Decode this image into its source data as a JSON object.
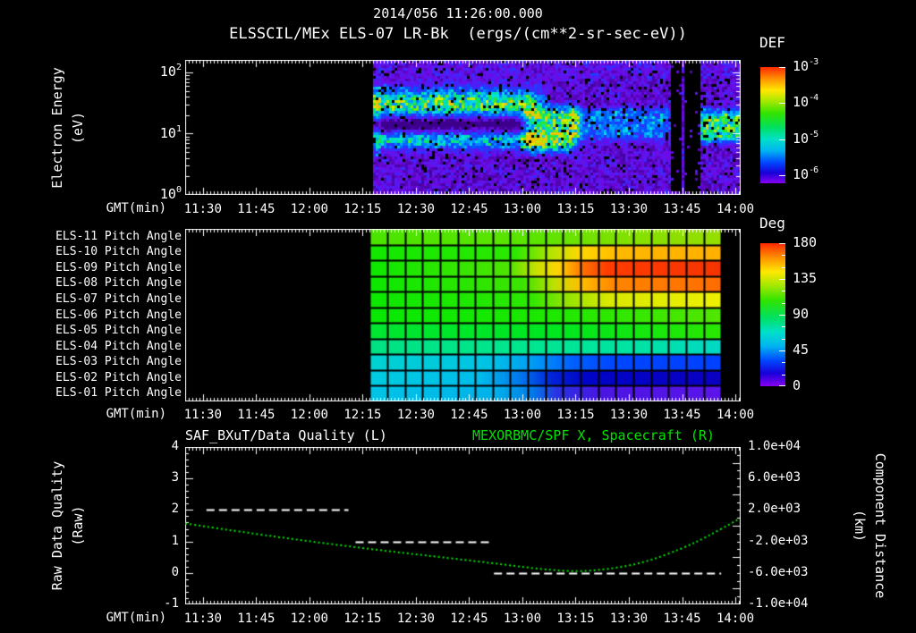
{
  "header": {
    "title": "2014/056 11:26:00.000",
    "subtitle": "ELSSCIL/MEx ELS-07 LR-Bk  (ergs/(cm**2-sr-sec-eV))"
  },
  "axes": {
    "gmt_label": "GMT(min)",
    "x_axis_start": "11:25",
    "x_axis_end": "14:01",
    "x_tick_labels": [
      "11:30",
      "11:45",
      "12:00",
      "12:15",
      "12:30",
      "12:45",
      "13:00",
      "13:15",
      "13:30",
      "13:45",
      "14:00"
    ]
  },
  "colorbars": {
    "def": {
      "title": "DEF",
      "ticks": [
        {
          "base": "10",
          "exp": "-3",
          "pos": 0.0
        },
        {
          "base": "10",
          "exp": "-4",
          "pos": 0.31
        },
        {
          "base": "10",
          "exp": "-5",
          "pos": 0.62
        },
        {
          "base": "10",
          "exp": "-6",
          "pos": 0.93
        }
      ]
    },
    "deg": {
      "title": "Deg",
      "ticks": [
        {
          "label": "180",
          "pos": 0.0
        },
        {
          "label": "135",
          "pos": 0.25
        },
        {
          "label": "90",
          "pos": 0.5
        },
        {
          "label": "45",
          "pos": 0.75
        },
        {
          "label": "0",
          "pos": 1.0
        }
      ]
    }
  },
  "panel1": {
    "ylabel_line1": "Electron Energy",
    "ylabel_line2": "(eV)",
    "y_ticks": [
      {
        "base": "10",
        "exp": "2",
        "pos": 0.09
      },
      {
        "base": "10",
        "exp": "1",
        "pos": 0.55
      },
      {
        "base": "10",
        "exp": "0",
        "pos": 1.0
      }
    ]
  },
  "panel3": {
    "title_left": "SAF_BXuT/Data Quality (L)",
    "title_right": "MEXORBMC/SPF X, Spacecraft (R)",
    "ylabel_left_line1": "Raw Data Quality",
    "ylabel_left_line2": "(Raw)",
    "ylabel_right_line1": "Component Distance",
    "ylabel_right_line2": "(km)",
    "left_ticks": [
      "4",
      "3",
      "2",
      "1",
      "0",
      "-1"
    ],
    "right_ticks": [
      {
        "label": "1.0e+04",
        "pos": 0.0
      },
      {
        "label": "6.0e+03",
        "pos": 0.2
      },
      {
        "label": "2.0e+03",
        "pos": 0.4
      },
      {
        "label": "-2.0e+03",
        "pos": 0.6
      },
      {
        "label": "-6.0e+03",
        "pos": 0.8
      },
      {
        "label": "-1.0e+04",
        "pos": 1.0
      }
    ]
  },
  "chart_data": [
    {
      "type": "heatmap",
      "title": "ELSSCIL/MEx ELS-07 LR-Bk",
      "units": "ergs/(cm**2-sr-sec-eV)",
      "xlabel": "GMT(min)",
      "ylabel": "Electron Energy (eV)",
      "yscale": "log",
      "ylim": [
        1,
        160
      ],
      "zlabel": "DEF",
      "zlim": [
        1e-06,
        0.001
      ],
      "data_start": "12:18",
      "data_end": "14:01",
      "gaps": [
        [
          "13:42",
          "13:45"
        ],
        [
          "13:46",
          "13:50"
        ]
      ],
      "background_noise": 0.15,
      "features": [
        {
          "kind": "band",
          "desc": "bright green mid-energy band ~30 eV",
          "energy_frac": 0.32,
          "sigma": 0.1,
          "amp": 0.58,
          "from": "12:18",
          "to": "13:02",
          "fade": 6
        },
        {
          "kind": "band",
          "desc": "cyan band ~8 eV",
          "energy_frac": 0.6,
          "sigma": 0.055,
          "amp": 0.42,
          "from": "12:18",
          "to": "13:05",
          "fade": 6
        },
        {
          "kind": "dark",
          "desc": "dark lane between bands",
          "energy_frac": 0.47,
          "sigma": 0.045,
          "amp": 0.22,
          "from": "12:18",
          "to": "13:03",
          "fade": 4
        },
        {
          "kind": "blob",
          "desc": "intense green blob",
          "from": "13:02",
          "to": "13:14",
          "y0": 0.3,
          "y1": 0.72,
          "amp": 0.55,
          "fade": 3
        },
        {
          "kind": "blob",
          "desc": "diffuse cyan patch",
          "from": "13:15",
          "to": "13:40",
          "y0": 0.33,
          "y1": 0.62,
          "amp": 0.28,
          "fade": 3
        },
        {
          "kind": "blob",
          "desc": "right green blob",
          "from": "13:50",
          "to": "14:01",
          "y0": 0.34,
          "y1": 0.64,
          "amp": 0.52,
          "fade": 3
        }
      ]
    },
    {
      "type": "heatmap",
      "xlabel": "GMT(min)",
      "zlabel": "Deg",
      "zlim": [
        0,
        180
      ],
      "data_start": "12:17",
      "data_end": "13:56",
      "columns": 20,
      "rows": [
        {
          "label": "ELS-11 Pitch Angle",
          "stops": [
            [
              "12:17",
              "#4ae400"
            ],
            [
              "13:05",
              "#5ce400"
            ],
            [
              "13:30",
              "#84e000"
            ],
            [
              "13:56",
              "#96de00"
            ]
          ]
        },
        {
          "label": "ELS-10 Pitch Angle",
          "stops": [
            [
              "12:17",
              "#12e800"
            ],
            [
              "12:58",
              "#2ce800"
            ],
            [
              "13:08",
              "#b4e400"
            ],
            [
              "13:16",
              "#ffd800"
            ],
            [
              "13:28",
              "#ffb800"
            ],
            [
              "13:56",
              "#ffb000"
            ]
          ]
        },
        {
          "label": "ELS-09 Pitch Angle",
          "stops": [
            [
              "12:17",
              "#0ce800"
            ],
            [
              "12:56",
              "#4ce400"
            ],
            [
              "13:04",
              "#cce000"
            ],
            [
              "13:10",
              "#ffd400"
            ],
            [
              "13:17",
              "#ff7000"
            ],
            [
              "13:24",
              "#ff3c00"
            ],
            [
              "13:56",
              "#f53400"
            ]
          ]
        },
        {
          "label": "ELS-08 Pitch Angle",
          "stops": [
            [
              "12:17",
              "#0ce800"
            ],
            [
              "13:00",
              "#3ce400"
            ],
            [
              "13:09",
              "#c0e000"
            ],
            [
              "13:16",
              "#ffc000"
            ],
            [
              "13:26",
              "#ff8400"
            ],
            [
              "13:56",
              "#ff6c00"
            ]
          ]
        },
        {
          "label": "ELS-07 Pitch Angle",
          "stops": [
            [
              "12:17",
              "#0ce800"
            ],
            [
              "13:02",
              "#2ce800"
            ],
            [
              "13:12",
              "#90e400"
            ],
            [
              "13:24",
              "#d8e800"
            ],
            [
              "13:56",
              "#eef000"
            ]
          ]
        },
        {
          "label": "ELS-06 Pitch Angle",
          "stops": [
            [
              "12:17",
              "#08e804"
            ],
            [
              "13:10",
              "#1ee800"
            ],
            [
              "13:56",
              "#52e600"
            ]
          ]
        },
        {
          "label": "ELS-05 Pitch Angle",
          "stops": [
            [
              "12:17",
              "#00e632"
            ],
            [
              "13:10",
              "#00e620"
            ],
            [
              "13:56",
              "#2ae700"
            ]
          ]
        },
        {
          "label": "ELS-04 Pitch Angle",
          "stops": [
            [
              "12:17",
              "#00e282"
            ],
            [
              "13:00",
              "#00e68e"
            ],
            [
              "13:35",
              "#00e2a6"
            ],
            [
              "13:56",
              "#00d8c6"
            ]
          ]
        },
        {
          "label": "ELS-03 Pitch Angle",
          "stops": [
            [
              "12:17",
              "#00d2d2"
            ],
            [
              "12:50",
              "#00c4e4"
            ],
            [
              "13:02",
              "#00a0f4"
            ],
            [
              "13:14",
              "#0060ff"
            ],
            [
              "13:26",
              "#0046ff"
            ],
            [
              "13:56",
              "#0040ff"
            ]
          ]
        },
        {
          "label": "ELS-02 Pitch Angle",
          "stops": [
            [
              "12:17",
              "#00cce0"
            ],
            [
              "12:48",
              "#00bcea"
            ],
            [
              "13:00",
              "#0072ee"
            ],
            [
              "13:08",
              "#0024d8"
            ],
            [
              "13:18",
              "#0004c6"
            ],
            [
              "13:56",
              "#0a00c2"
            ]
          ]
        },
        {
          "label": "ELS-01 Pitch Angle",
          "stops": [
            [
              "12:17",
              "#00c4e6"
            ],
            [
              "12:52",
              "#00b2ea"
            ],
            [
              "13:02",
              "#0080ea"
            ],
            [
              "13:10",
              "#2a30e2"
            ],
            [
              "13:22",
              "#4a16e2"
            ],
            [
              "13:56",
              "#5c14ea"
            ]
          ]
        }
      ]
    },
    {
      "type": "line",
      "title_left": "SAF_BXuT/Data Quality (L)",
      "title_right": "MEXORBMC/SPF X, Spacecraft (R)",
      "xlabel": "GMT(min)",
      "ylabel_left": "Raw Data Quality (Raw)",
      "ylim_left": [
        -1,
        4
      ],
      "ylabel_right": "Component Distance (km)",
      "ylim_right": [
        -10000,
        10000
      ],
      "quality_segments": [
        {
          "value": 2,
          "from": "11:31",
          "to": "12:11"
        },
        {
          "value": 1,
          "from": "12:13",
          "to": "12:51"
        },
        {
          "value": 0,
          "from": "12:52",
          "to": "13:56"
        }
      ],
      "distance_curve": {
        "name": "Spacecraft X component distance",
        "color": "#00e400",
        "points": [
          [
            "11:25",
            300
          ],
          [
            "11:40",
            -700
          ],
          [
            "12:00",
            -1900
          ],
          [
            "12:20",
            -3100
          ],
          [
            "12:40",
            -4100
          ],
          [
            "12:55",
            -4900
          ],
          [
            "13:05",
            -5500
          ],
          [
            "13:15",
            -5800
          ],
          [
            "13:25",
            -5500
          ],
          [
            "13:35",
            -4600
          ],
          [
            "13:45",
            -2800
          ],
          [
            "13:52",
            -1400
          ],
          [
            "14:01",
            900
          ]
        ]
      }
    }
  ]
}
